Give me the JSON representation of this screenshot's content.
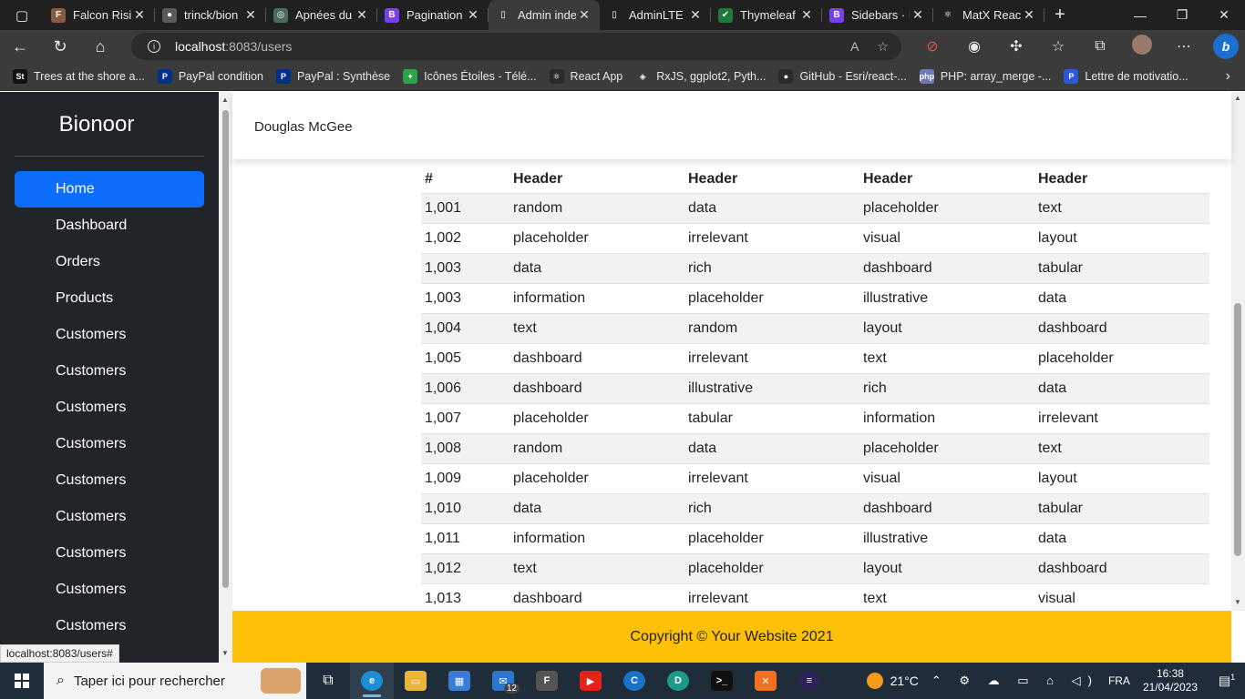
{
  "browser": {
    "tabs": [
      {
        "label": "Falcon Risi",
        "icon": "falcon-icon",
        "color": "#8a5a3c",
        "glyph": "F",
        "active": false
      },
      {
        "label": "trinck/bion",
        "icon": "github-icon",
        "color": "#5a5a5a",
        "glyph": "●",
        "active": false
      },
      {
        "label": "Apnées du",
        "icon": "globe-icon",
        "color": "#4a6a5a",
        "glyph": "◎",
        "active": false
      },
      {
        "label": "Pagination",
        "icon": "bootstrap-icon",
        "color": "#7b3ff2",
        "glyph": "B",
        "active": false
      },
      {
        "label": "Admin inde",
        "icon": "page-icon",
        "color": "#3b3b3b",
        "glyph": "▯",
        "active": true
      },
      {
        "label": "AdminLTE",
        "icon": "page-icon",
        "color": "#202020",
        "glyph": "▯",
        "active": false
      },
      {
        "label": "Thymeleaf",
        "icon": "check-icon",
        "color": "#1e7a3a",
        "glyph": "✔",
        "active": false
      },
      {
        "label": "Sidebars · E",
        "icon": "bootstrap-icon",
        "color": "#7b3ff2",
        "glyph": "B",
        "active": false
      },
      {
        "label": "MatX Reac",
        "icon": "react-icon",
        "color": "#202020",
        "glyph": "⚛",
        "active": false
      }
    ],
    "url_host": "localhost",
    "url_path": ":8083/users",
    "bookmarks": [
      {
        "label": "Trees at the shore a...",
        "icon": "st-icon",
        "color": "#111111",
        "glyph": "St"
      },
      {
        "label": "PayPal condition",
        "icon": "paypal-icon",
        "color": "#003087",
        "glyph": "P"
      },
      {
        "label": "PayPal : Synthèse",
        "icon": "paypal-icon",
        "color": "#003087",
        "glyph": "P"
      },
      {
        "label": "Icônes Étoiles - Télé...",
        "icon": "star-app-icon",
        "color": "#2aa34a",
        "glyph": "✦"
      },
      {
        "label": "React App",
        "icon": "react-icon",
        "color": "#2b2b2b",
        "glyph": "⚛"
      },
      {
        "label": "RxJS, ggplot2, Pyth...",
        "icon": "rxjs-icon",
        "color": "#3b3b3b",
        "glyph": "◈"
      },
      {
        "label": "GitHub - Esri/react-...",
        "icon": "github-icon",
        "color": "#2b2b2b",
        "glyph": "●"
      },
      {
        "label": "PHP: array_merge -...",
        "icon": "php-icon",
        "color": "#6f79b5",
        "glyph": "php"
      },
      {
        "label": "Lettre de motivatio...",
        "icon": "p-letter-icon",
        "color": "#2a58d9",
        "glyph": "P"
      }
    ]
  },
  "sidebar": {
    "brand": "Bionoor",
    "items": [
      {
        "label": "Home",
        "active": true
      },
      {
        "label": "Dashboard",
        "active": false
      },
      {
        "label": "Orders",
        "active": false
      },
      {
        "label": "Products",
        "active": false
      },
      {
        "label": "Customers",
        "active": false
      },
      {
        "label": "Customers",
        "active": false
      },
      {
        "label": "Customers",
        "active": false
      },
      {
        "label": "Customers",
        "active": false
      },
      {
        "label": "Customers",
        "active": false
      },
      {
        "label": "Customers",
        "active": false
      },
      {
        "label": "Customers",
        "active": false
      },
      {
        "label": "Customers",
        "active": false
      },
      {
        "label": "Customers",
        "active": false
      }
    ]
  },
  "topbar": {
    "user_name": "Douglas McGee"
  },
  "table": {
    "headers": [
      "#",
      "Header",
      "Header",
      "Header",
      "Header"
    ],
    "rows": [
      [
        "1,001",
        "random",
        "data",
        "placeholder",
        "text"
      ],
      [
        "1,002",
        "placeholder",
        "irrelevant",
        "visual",
        "layout"
      ],
      [
        "1,003",
        "data",
        "rich",
        "dashboard",
        "tabular"
      ],
      [
        "1,003",
        "information",
        "placeholder",
        "illustrative",
        "data"
      ],
      [
        "1,004",
        "text",
        "random",
        "layout",
        "dashboard"
      ],
      [
        "1,005",
        "dashboard",
        "irrelevant",
        "text",
        "placeholder"
      ],
      [
        "1,006",
        "dashboard",
        "illustrative",
        "rich",
        "data"
      ],
      [
        "1,007",
        "placeholder",
        "tabular",
        "information",
        "irrelevant"
      ],
      [
        "1,008",
        "random",
        "data",
        "placeholder",
        "text"
      ],
      [
        "1,009",
        "placeholder",
        "irrelevant",
        "visual",
        "layout"
      ],
      [
        "1,010",
        "data",
        "rich",
        "dashboard",
        "tabular"
      ],
      [
        "1,011",
        "information",
        "placeholder",
        "illustrative",
        "data"
      ],
      [
        "1,012",
        "text",
        "placeholder",
        "layout",
        "dashboard"
      ],
      [
        "1,013",
        "dashboard",
        "irrelevant",
        "text",
        "visual"
      ]
    ]
  },
  "footer": {
    "text": "Copyright © Your Website 2021"
  },
  "status_bar": {
    "url": "localhost:8083/users#"
  },
  "taskbar": {
    "search_placeholder": "Taper ici pour rechercher",
    "weather": "21°C",
    "language": "FRA",
    "time": "16:38",
    "date": "21/04/2023",
    "mail_badge": "12",
    "notification_count": "1"
  },
  "colors": {
    "sidebar_bg": "#212529",
    "active_nav": "#0d6efd",
    "footer_bg": "#ffc107"
  }
}
